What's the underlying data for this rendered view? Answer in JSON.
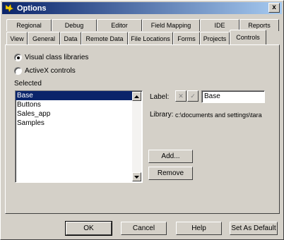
{
  "window": {
    "title": "Options",
    "close_glyph": "x"
  },
  "tabs_back": [
    {
      "label": "Regional"
    },
    {
      "label": "Debug"
    },
    {
      "label": "Editor"
    },
    {
      "label": "Field Mapping"
    },
    {
      "label": "IDE"
    },
    {
      "label": "Reports"
    }
  ],
  "tabs_front": [
    {
      "label": "View"
    },
    {
      "label": "General"
    },
    {
      "label": "Data"
    },
    {
      "label": "Remote Data"
    },
    {
      "label": "File Locations"
    },
    {
      "label": "Forms"
    },
    {
      "label": "Projects"
    },
    {
      "label": "Controls"
    }
  ],
  "controls": {
    "radio_visual": "Visual class libraries",
    "radio_activex": "ActiveX controls",
    "selected_label": "Selected",
    "list_items": [
      "Base",
      "Buttons",
      "Sales_app",
      "Samples"
    ],
    "label_field": "Label:",
    "label_value": "Base",
    "library_field": "Library:",
    "library_value": "c:\\documents and settings\\tara",
    "add_button": "Add...",
    "remove_button": "Remove"
  },
  "footer": {
    "ok": "OK",
    "cancel": "Cancel",
    "help": "Help",
    "set_default": "Set As Default"
  },
  "colors": {
    "title_bar": "#0a246a",
    "selection": "#0a246a",
    "face": "#d4d0c8"
  }
}
